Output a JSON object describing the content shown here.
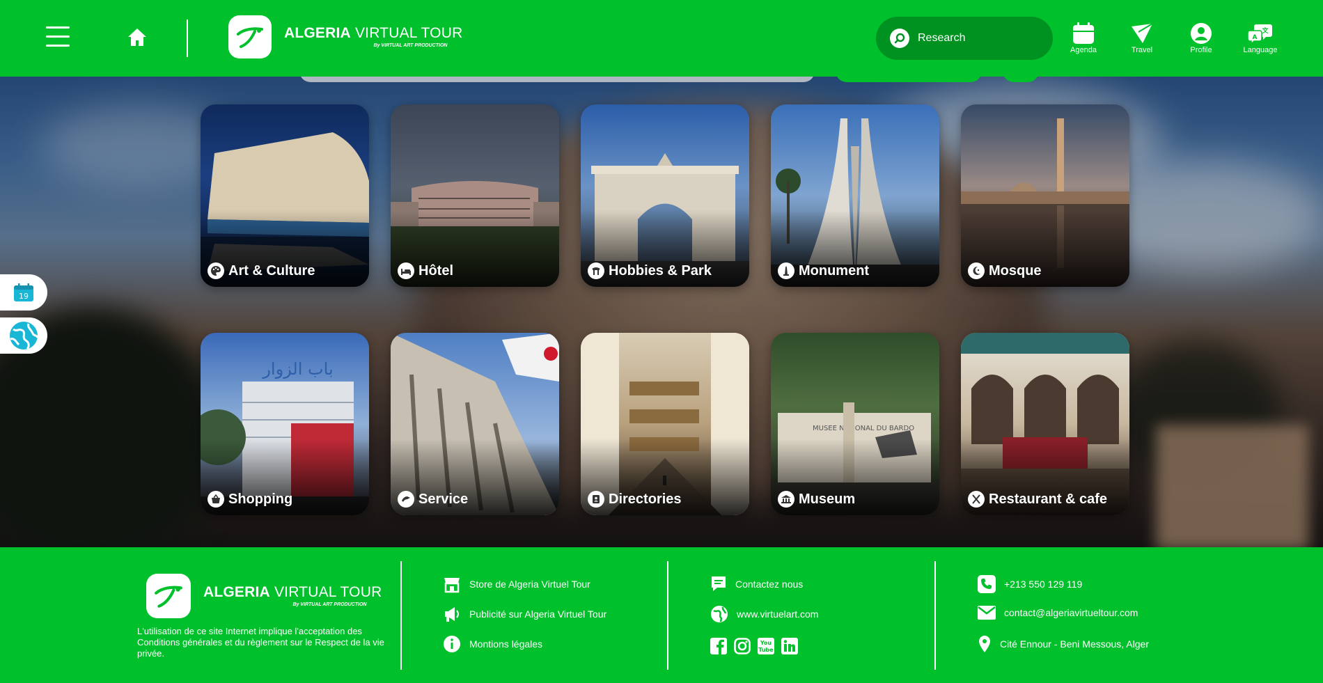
{
  "header": {
    "brand_bold": "ALGERIA",
    "brand_rest": "VIRTUAL TOUR",
    "brand_byline": "By VIRTUAL ART PRODUCTION",
    "search_label": "Research",
    "nav": [
      {
        "label": "Agenda",
        "icon": "calendar-icon"
      },
      {
        "label": "Travel",
        "icon": "travel-icon"
      },
      {
        "label": "Profile",
        "icon": "profile-icon"
      },
      {
        "label": "Language",
        "icon": "language-icon"
      }
    ]
  },
  "side": {
    "calendar_day": "19"
  },
  "categories": [
    {
      "label": "Art & Culture",
      "icon": "palette-icon"
    },
    {
      "label": "Hôtel",
      "icon": "bed-icon"
    },
    {
      "label": "Hobbies & Park",
      "icon": "park-icon"
    },
    {
      "label": "Monument",
      "icon": "monument-icon"
    },
    {
      "label": "Mosque",
      "icon": "crescent-icon"
    },
    {
      "label": "Shopping",
      "icon": "basket-icon"
    },
    {
      "label": "Service",
      "icon": "service-icon"
    },
    {
      "label": "Directories",
      "icon": "directory-icon"
    },
    {
      "label": "Museum",
      "icon": "museum-icon"
    },
    {
      "label": "Restaurant & cafe",
      "icon": "cutlery-icon"
    }
  ],
  "footer": {
    "brand_bold": "ALGERIA",
    "brand_rest": "VIRTUAL TOUR",
    "brand_byline": "By VIRTUAL ART PRODUCTION",
    "disclaimer": "L'utilisation de ce site Internet implique l'acceptation des Conditions générales et du règlement sur le Respect de la vie privée.",
    "links": [
      {
        "label": "Store de Algeria Virtuel Tour",
        "icon": "store-icon"
      },
      {
        "label": "Publicité sur Algeria Virtuel Tour",
        "icon": "megaphone-icon"
      },
      {
        "label": "Montions légales",
        "icon": "info-icon"
      }
    ],
    "contact": {
      "contact_label": "Contactez nous",
      "website": "www.virtuelart.com"
    },
    "social": [
      "facebook-icon",
      "instagram-icon",
      "youtube-icon",
      "linkedin-icon"
    ],
    "info": {
      "phone": "+213 550 129 119",
      "email": "contact@algeriavirtueltour.com",
      "address": "Cité Ennour - Beni Messous, Alger"
    }
  }
}
